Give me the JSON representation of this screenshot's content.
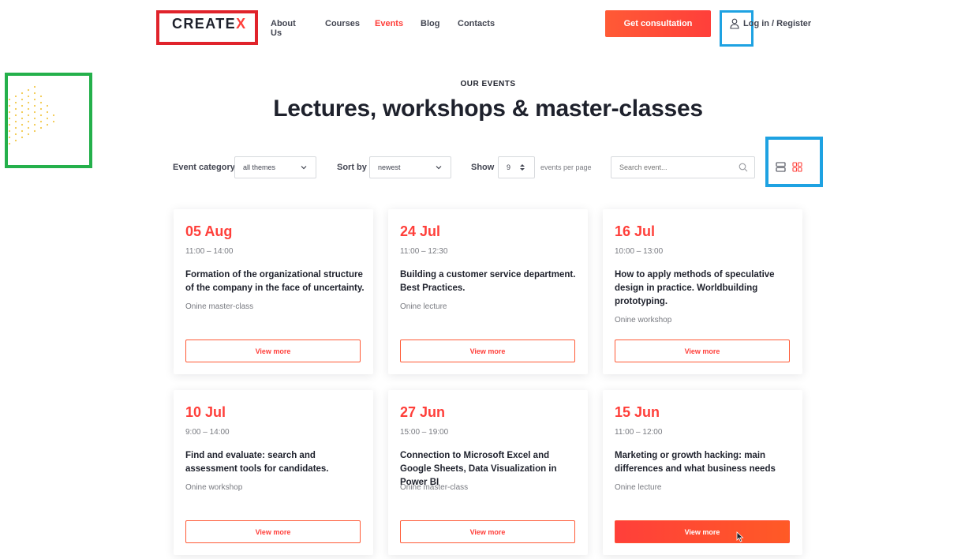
{
  "header": {
    "logo": {
      "text": "CREATE",
      "accent": "X"
    },
    "nav": [
      "About Us",
      "Courses",
      "Events",
      "Blog",
      "Contacts"
    ],
    "active_nav": "Events",
    "cta_label": "Get consultation",
    "login_label": "Log in / Register"
  },
  "hero": {
    "eyebrow": "OUR EVENTS",
    "title": "Lectures, workshops & master-classes"
  },
  "filters": {
    "category_label": "Event category",
    "category_value": "all themes",
    "sort_label": "Sort by",
    "sort_value": "newest",
    "show_label": "Show",
    "show_value": "9",
    "per_page_label": "events per page",
    "search_placeholder": "Search event..."
  },
  "events": [
    {
      "date": "05 Aug",
      "time": "11:00 – 14:00",
      "title": "Formation of the organizational structure of the company in the face of uncertainty.",
      "type": "Onine master-class",
      "button": "View more"
    },
    {
      "date": "24 Jul",
      "time": "11:00 – 12:30",
      "title": "Building a customer service department. Best Practices.",
      "type": "Onine lecture",
      "button": "View more"
    },
    {
      "date": "16 Jul",
      "time": "10:00 – 13:00",
      "title": "How to apply methods of speculative design in practice. Worldbuilding prototyping.",
      "type": "Onine  workshop",
      "button": "View more"
    },
    {
      "date": "10 Jul",
      "time": "9:00 – 14:00",
      "title": "Find and evaluate: search and assessment tools for candidates.",
      "type": "Onine workshop",
      "button": "View more"
    },
    {
      "date": "27 Jun",
      "time": "15:00 – 19:00",
      "title": "Connection to Microsoft Excel and Google Sheets, Data Visualization in Power BI",
      "type": "Onine master-class",
      "button": "View more"
    },
    {
      "date": "15 Jun",
      "time": "11:00 – 12:00",
      "title": "Marketing or growth hacking: main differences and what business needs",
      "type": "Onine  lecture",
      "button": "View more"
    }
  ],
  "colors": {
    "accent": "#ff3f3a",
    "highlight_red": "#e0232b",
    "highlight_blue": "#1ea2e2",
    "highlight_green": "#24b04b"
  },
  "icons": [
    "user-icon",
    "chevron-down-icon",
    "stepper-icon",
    "search-icon",
    "list-view-icon",
    "grid-view-icon",
    "cursor-icon"
  ]
}
